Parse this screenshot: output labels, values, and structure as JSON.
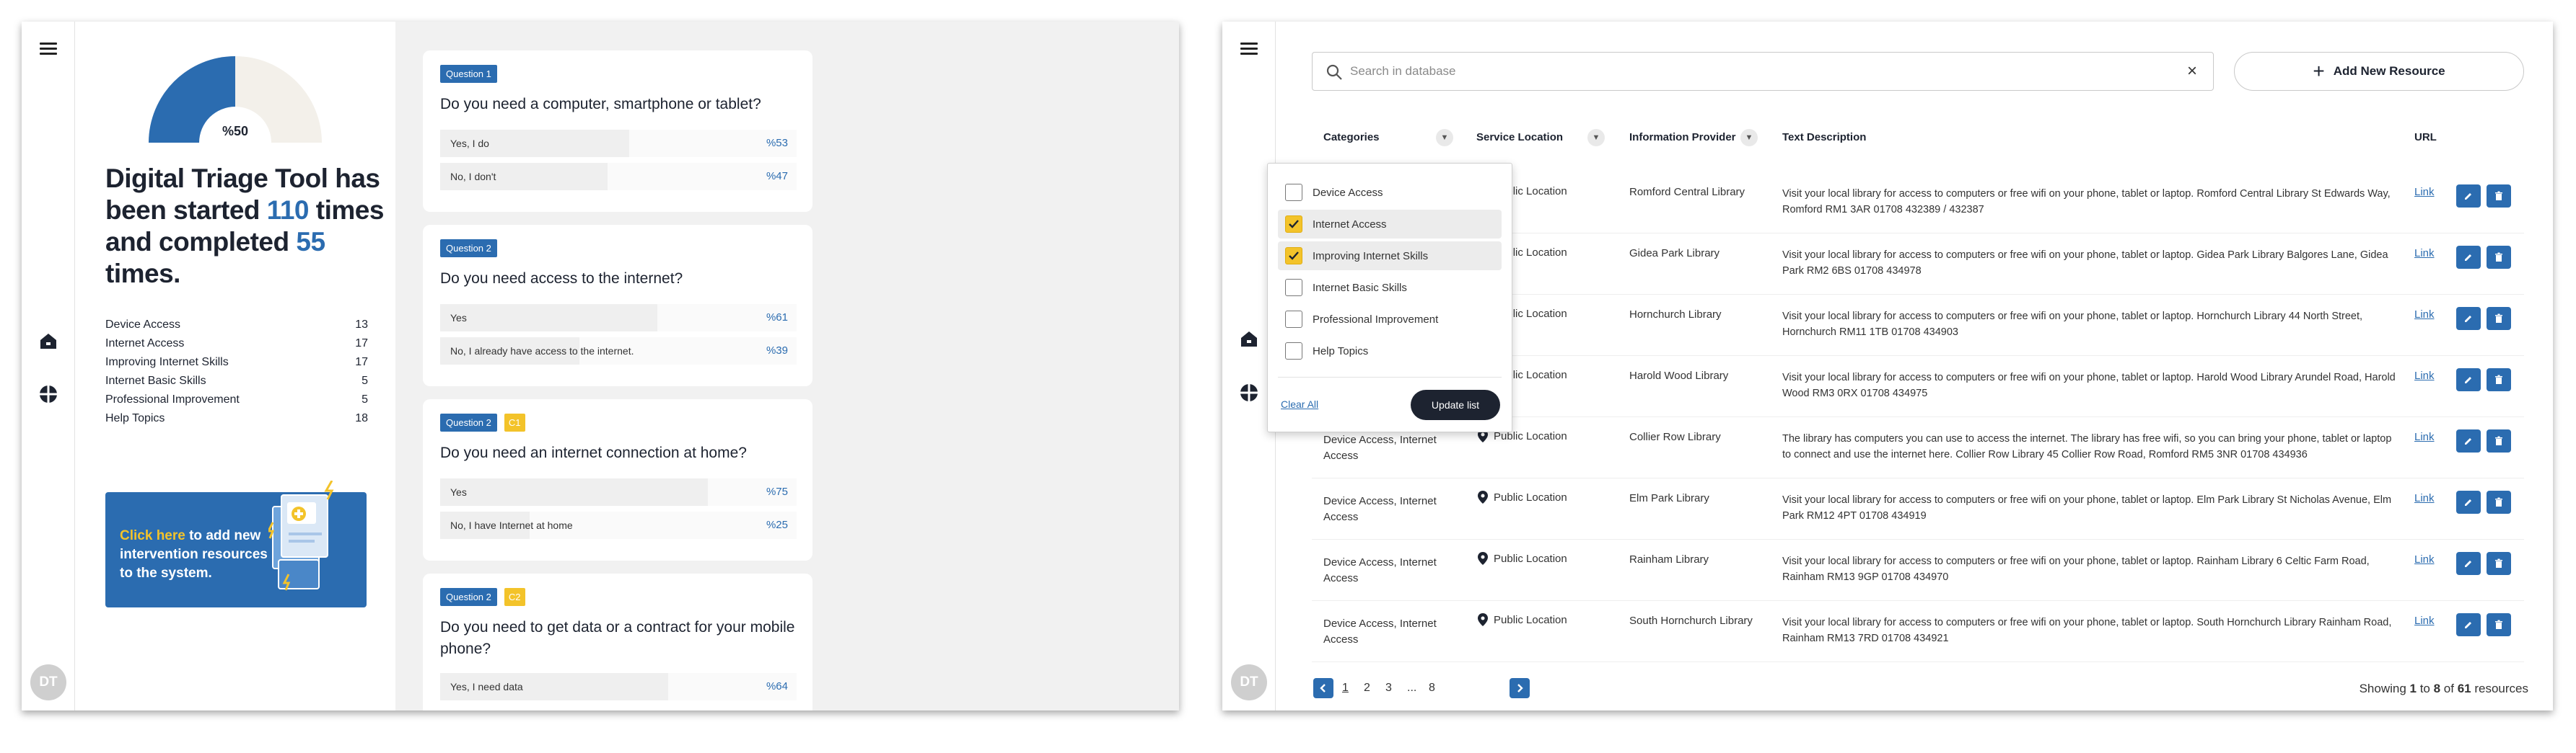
{
  "left_app": {
    "gauge": {
      "label": "%50",
      "value": 0.5,
      "fill_color": "#2b6cb0",
      "track_color": "#f3f0ea"
    },
    "headline": {
      "p1": "Digital Triage Tool has been started ",
      "started": "110",
      "p2": " times and completed ",
      "completed": "55",
      "p3": " times."
    },
    "categories": [
      {
        "name": "Device Access",
        "count": "13"
      },
      {
        "name": "Internet Access",
        "count": "17"
      },
      {
        "name": "Improving Internet Skills",
        "count": "17"
      },
      {
        "name": "Internet Basic Skills",
        "count": "5"
      },
      {
        "name": "Professional Improvement",
        "count": "5"
      },
      {
        "name": "Help Topics",
        "count": "18"
      }
    ],
    "promo": {
      "link": "Click here",
      "text": " to add new intervention resources to the system."
    },
    "avatar": "DT",
    "questions": [
      {
        "tag": "Question 1",
        "title": "Do you need a computer, smartphone or tablet?",
        "answers": [
          {
            "text": "Yes, I do",
            "pct": "%53",
            "value": 0.53
          },
          {
            "text": "No, I don't",
            "pct": "%47",
            "value": 0.47
          }
        ]
      },
      {
        "tag": "Question 2",
        "title": "Do you need access to the internet?",
        "answers": [
          {
            "text": "Yes",
            "pct": "%61",
            "value": 0.61
          },
          {
            "text": "No, I already have access to the internet.",
            "pct": "%39",
            "value": 0.39
          }
        ]
      },
      {
        "tag": "Question 2",
        "ctag": "C1",
        "title": "Do you need an internet connection at home?",
        "answers": [
          {
            "text": "Yes",
            "pct": "%75",
            "value": 0.75
          },
          {
            "text": "No, I have Internet at home",
            "pct": "%25",
            "value": 0.25
          }
        ]
      },
      {
        "tag": "Question 2",
        "ctag": "C2",
        "title": "Do you need to get data or a contract for your mobile phone?",
        "answers": [
          {
            "text": "Yes, I need data",
            "pct": "%64",
            "value": 0.64
          }
        ]
      }
    ]
  },
  "right_app": {
    "search": {
      "placeholder": "Search in database",
      "clear": "×"
    },
    "add_button": "Add New Resource",
    "columns": {
      "categories": "Categories",
      "location": "Service Location",
      "provider": "Information Provider",
      "description": "Text Description",
      "url": "URL"
    },
    "filter": {
      "options": [
        {
          "label": "Device Access",
          "checked": false
        },
        {
          "label": "Internet Access",
          "checked": true
        },
        {
          "label": "Improving Internet Skills",
          "checked": true
        },
        {
          "label": "Internet Basic Skills",
          "checked": false
        },
        {
          "label": "Professional Improvement",
          "checked": false
        },
        {
          "label": "Help Topics",
          "checked": false
        }
      ],
      "clear_all": "Clear All",
      "update": "Update list"
    },
    "rows": [
      {
        "categories": "",
        "location": "Public Location",
        "provider": "Romford Central Library",
        "description": "Visit your local library for access to computers or free wifi on your phone, tablet or laptop. Romford Central Library St Edwards Way, Romford RM1 3AR 01708 432389 / 432387",
        "link": "Link"
      },
      {
        "categories": "",
        "location": "Public Location",
        "provider": "Gidea Park Library",
        "description": "Visit your local library for access to computers or free wifi on your phone, tablet or laptop. Gidea Park Library Balgores Lane, Gidea Park RM2 6BS 01708 434978",
        "link": "Link"
      },
      {
        "categories": "",
        "location": "Public Location",
        "provider": "Hornchurch Library",
        "description": "Visit your local library for access to computers or free wifi on your phone, tablet or laptop. Hornchurch Library 44 North Street, Hornchurch RM11 1TB 01708 434903",
        "link": "Link"
      },
      {
        "categories": "",
        "location": "Public Location",
        "provider": "Harold Wood Library",
        "description": "Visit your local library for access to computers or free wifi on your phone, tablet or laptop. Harold Wood Library Arundel Road, Harold Wood RM3 0RX 01708 434975",
        "link": "Link"
      },
      {
        "categories": "Device Access, Internet Access",
        "location": "Public Location",
        "provider": "Collier Row Library",
        "description": "The library has computers you can use to access the internet. The library has free wifi, so you can bring your phone, tablet or laptop to connect and use the internet here. Collier Row Library 45 Collier Row Road, Romford RM5 3NR 01708 434936",
        "link": "Link"
      },
      {
        "categories": "Device Access, Internet Access",
        "location": "Public Location",
        "provider": "Elm Park Library",
        "description": "Visit your local library for access to computers or free wifi on your phone, tablet or laptop. Elm Park Library St Nicholas Avenue, Elm Park RM12 4PT 01708 434919",
        "link": "Link"
      },
      {
        "categories": "Device Access, Internet Access",
        "location": "Public Location",
        "provider": "Rainham Library",
        "description": "Visit your local library for access to computers or free wifi on your phone, tablet or laptop. Rainham Library 6 Celtic Farm Road, Rainham RM13 9GP 01708 434970",
        "link": "Link"
      },
      {
        "categories": "Device Access, Internet Access",
        "location": "Public Location",
        "provider": "South Hornchurch Library",
        "description": "Visit your local library for access to computers or free wifi on your phone, tablet or laptop. South Hornchurch Library Rainham Road, Rainham RM13 7RD 01708 434921",
        "link": "Link"
      }
    ],
    "pagination": {
      "pages": [
        "1",
        "2",
        "3",
        "...",
        "8"
      ],
      "current": "1",
      "showing": {
        "p1": "Showing ",
        "from": "1",
        "p2": " to ",
        "to": "8",
        "p3": " of ",
        "total": "61",
        "p4": " resources"
      }
    },
    "avatar": "DT"
  },
  "colors": {
    "accent": "#2b6cb0",
    "highlight": "#f3c32a",
    "dark": "#1d2330"
  }
}
